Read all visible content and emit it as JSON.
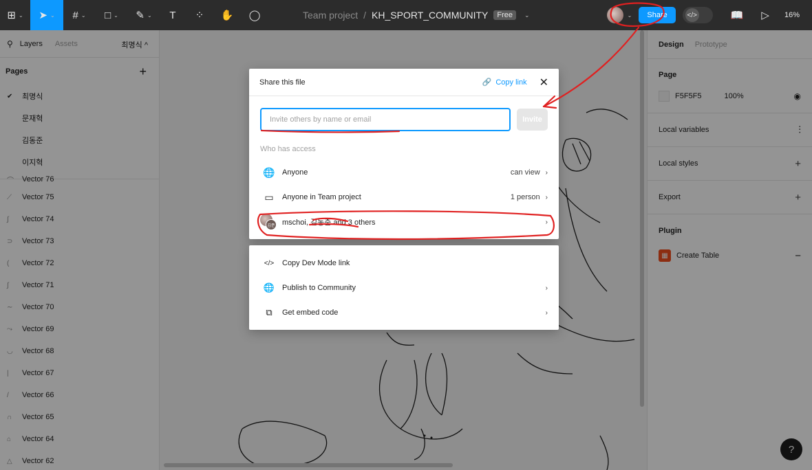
{
  "toolbar": {
    "tools": [
      {
        "icon": "figma-menu-icon",
        "glyph": "⊞"
      },
      {
        "icon": "move-tool-icon",
        "glyph": "➤"
      },
      {
        "icon": "frame-tool-icon",
        "glyph": "#"
      },
      {
        "icon": "shape-tool-icon",
        "glyph": "□"
      },
      {
        "icon": "pen-tool-icon",
        "glyph": "✎"
      },
      {
        "icon": "text-tool-icon",
        "glyph": "T"
      },
      {
        "icon": "resources-icon",
        "glyph": "⁘"
      },
      {
        "icon": "hand-tool-icon",
        "glyph": "✋"
      },
      {
        "icon": "comment-tool-icon",
        "glyph": "◯"
      }
    ],
    "team": "Team project",
    "separator": "/",
    "file_name": "KH_SPORT_COMMUNITY",
    "plan_badge": "Free",
    "share_label": "Share",
    "dev_mode_glyph": "</>",
    "library_glyph": "📖",
    "present_glyph": "▷",
    "zoom": "16%"
  },
  "left": {
    "tabs": {
      "layers": "Layers",
      "assets": "Assets",
      "page_selector": "최명식 ^"
    },
    "pages_title": "Pages",
    "pages": [
      {
        "label": "최명식",
        "current": true
      },
      {
        "label": "문재혁",
        "current": false
      },
      {
        "label": "김동준",
        "current": false
      },
      {
        "label": "이지혁",
        "current": false
      }
    ],
    "layers": [
      "Vector 76",
      "Vector 75",
      "Vector 74",
      "Vector 73",
      "Vector 72",
      "Vector 71",
      "Vector 70",
      "Vector 69",
      "Vector 68",
      "Vector 67",
      "Vector 66",
      "Vector 65",
      "Vector 64",
      "Vector 62"
    ]
  },
  "right": {
    "tabs": {
      "design": "Design",
      "prototype": "Prototype"
    },
    "page_title": "Page",
    "page_color": "F5F5F5",
    "page_opacity": "100%",
    "local_variables": "Local variables",
    "local_styles": "Local styles",
    "export": "Export",
    "plugin_title": "Plugin",
    "plugin_name": "Create Table",
    "help": "?"
  },
  "share_dialog": {
    "title": "Share this file",
    "copy_link": "Copy link",
    "invite_placeholder": "Invite others by name or email",
    "invite_button": "Invite",
    "who_has_access": "Who has access",
    "access": [
      {
        "icon": "globe-icon",
        "glyph": "🌐",
        "label": "Anyone",
        "value": "can view"
      },
      {
        "icon": "folder-icon",
        "glyph": "▭",
        "label": "Anyone in Team project",
        "value": "1 person"
      },
      {
        "icon": "avatars-icon",
        "glyph": "",
        "label": "mschoi, 김동준 and 3 others",
        "value": ""
      }
    ],
    "avatar_initials": "김준"
  },
  "more_menu": [
    {
      "icon": "code-icon",
      "glyph": "</>",
      "label": "Copy Dev Mode link",
      "chevron": false
    },
    {
      "icon": "globe-icon",
      "glyph": "🌐",
      "label": "Publish to Community",
      "chevron": true
    },
    {
      "icon": "embed-icon",
      "glyph": "⧉",
      "label": "Get embed code",
      "chevron": true
    }
  ],
  "colors": {
    "accent": "#0d99ff",
    "annotation": "#e02020"
  }
}
